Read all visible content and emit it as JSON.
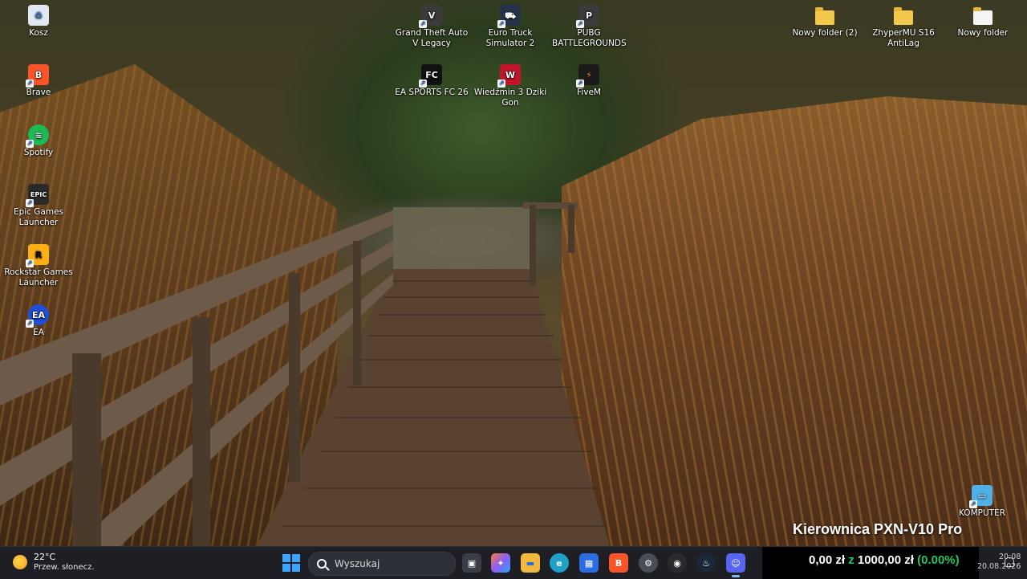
{
  "desktop": {
    "left_icons": [
      {
        "label": "Kosz",
        "icon": "recycle-bin-icon",
        "color": "#dfe8f3"
      },
      {
        "label": "Brave",
        "icon": "brave-icon",
        "color": "#fb542b"
      },
      {
        "label": "Spotify",
        "icon": "spotify-icon",
        "color": "#1db954"
      },
      {
        "label": "Epic Games Launcher",
        "icon": "epic-games-icon",
        "color": "#2a2a2a"
      },
      {
        "label": "Rockstar Games Launcher",
        "icon": "rockstar-icon",
        "color": "#fcaf17"
      },
      {
        "label": "EA",
        "icon": "ea-icon",
        "color": "#1f4ed8"
      }
    ],
    "top_icons": [
      {
        "label": "Grand Theft Auto V Legacy",
        "icon": "gta-icon",
        "color": "#3a3a3a"
      },
      {
        "label": "Euro Truck Simulator 2",
        "icon": "ets2-icon",
        "color": "#24324a"
      },
      {
        "label": "PUBG BATTLEGROUNDS",
        "icon": "pubg-icon",
        "color": "#3b3b3b"
      },
      {
        "label": "EA SPORTS FC 26",
        "icon": "fc26-icon",
        "color": "#111111"
      },
      {
        "label": "Wiedźmin 3 Dziki Gon",
        "icon": "witcher-icon",
        "color": "#c0152a"
      },
      {
        "label": "FiveM",
        "icon": "fivem-icon",
        "color": "#1b1b1b"
      }
    ],
    "right_icons": [
      {
        "label": "Nowy folder (2)",
        "icon": "folder-icon"
      },
      {
        "label": "ZhyperMU S16 AntiLag",
        "icon": "folder-icon"
      },
      {
        "label": "Nowy folder",
        "icon": "folder-icon"
      }
    ],
    "computer_icon": {
      "label": "KOMPUTER",
      "icon": "computer-icon"
    }
  },
  "overlay": {
    "title": "Kierownica PXN-V10 Pro",
    "amount_current": "0,00 zł",
    "separator": "z",
    "amount_goal": "1000,00 zł",
    "percent": "(0.00%)"
  },
  "taskbar": {
    "weather": {
      "temp": "22°C",
      "desc": "Przew. słonecz."
    },
    "search_placeholder": "Wyszukaj",
    "apps": [
      {
        "name": "task-view-icon",
        "color": "#3a3d45"
      },
      {
        "name": "copilot-icon",
        "color": "#8e5cf7"
      },
      {
        "name": "file-explorer-icon",
        "color": "#f2b93b"
      },
      {
        "name": "edge-icon",
        "color": "#1fa0c9"
      },
      {
        "name": "store-icon",
        "color": "#2b6de0"
      },
      {
        "name": "brave-icon",
        "color": "#fb542b"
      },
      {
        "name": "settings-icon",
        "color": "#4a4d55"
      },
      {
        "name": "obs-icon",
        "color": "#2b2b2b"
      },
      {
        "name": "steam-icon",
        "color": "#1b2838"
      },
      {
        "name": "discord-icon",
        "color": "#5865f2"
      }
    ],
    "clock": {
      "time": "20:08",
      "date": "20.08.2026"
    }
  }
}
